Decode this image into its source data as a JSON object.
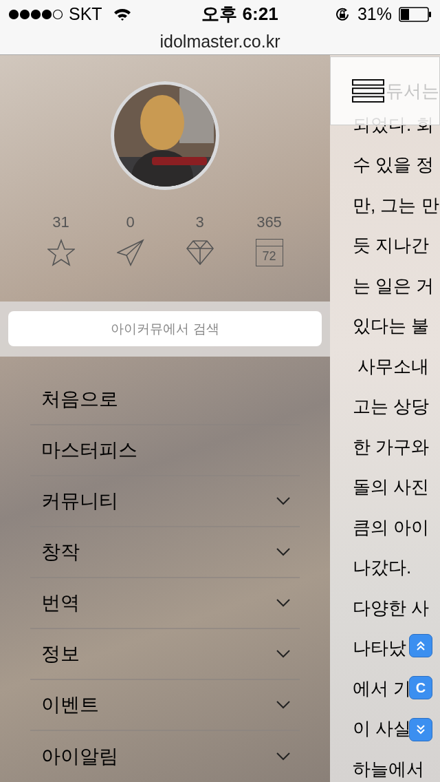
{
  "status_bar": {
    "carrier": "SKT",
    "time": "오후 6:21",
    "battery": "31%"
  },
  "address_bar": {
    "url": "idolmaster.co.kr"
  },
  "profile": {
    "stats": [
      {
        "kind": "star",
        "count": "31"
      },
      {
        "kind": "send",
        "count": "0"
      },
      {
        "kind": "diamond",
        "count": "3"
      },
      {
        "kind": "calendar",
        "count": "365",
        "day": "72"
      }
    ]
  },
  "search": {
    "placeholder": "아이커뮤에서 검색"
  },
  "menu": [
    {
      "label": "처음으로",
      "expandable": false
    },
    {
      "label": "마스터피스",
      "expandable": false
    },
    {
      "label": "커뮤니티",
      "expandable": true
    },
    {
      "label": "창작",
      "expandable": true
    },
    {
      "label": "번역",
      "expandable": true
    },
    {
      "label": "정보",
      "expandable": true
    },
    {
      "label": "이벤트",
      "expandable": true
    },
    {
      "label": "아이알림",
      "expandable": true
    }
  ],
  "article": {
    "lines": [
      "듀서는",
      "되었다. 회",
      "수 있을 정",
      "만, 그는 만",
      "듯 지나간",
      "는 일은 거",
      "있다는 불",
      " 사무소내",
      "고는 상당",
      "한 가구와",
      "돌의 사진",
      "큼의 아이",
      "나갔다.",
      "다양한 사",
      "나타났",
      "에서 기",
      "이 사실",
      "하늘에서"
    ]
  },
  "floating_buttons": [
    {
      "kind": "up"
    },
    {
      "kind": "letter",
      "label": "C"
    },
    {
      "kind": "down"
    }
  ]
}
